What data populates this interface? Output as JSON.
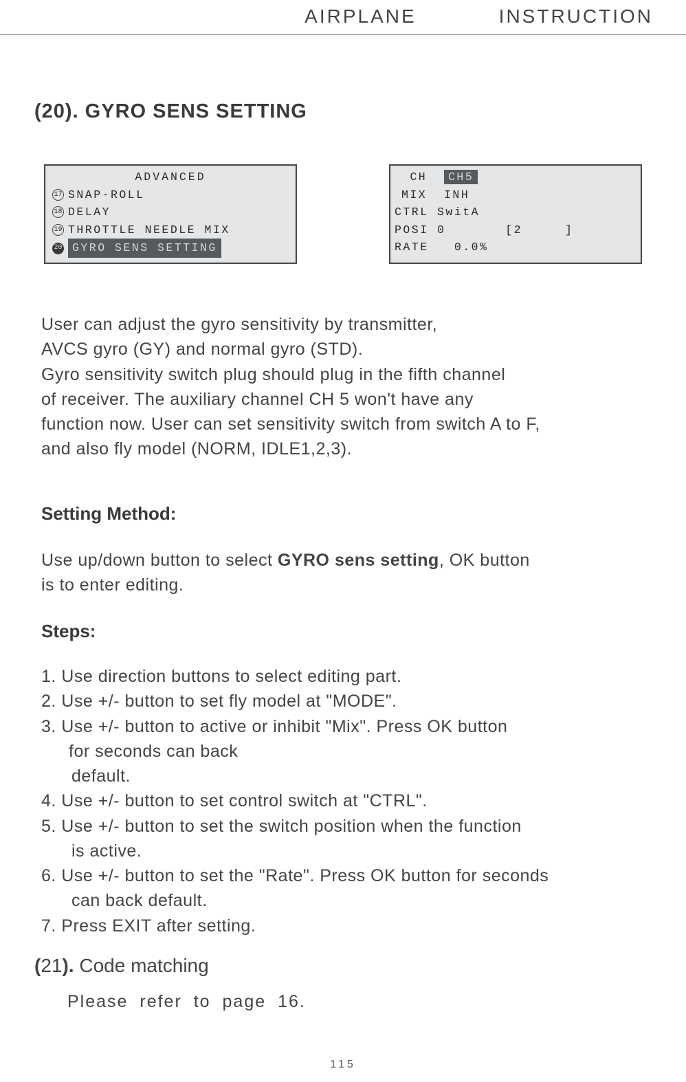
{
  "header": {
    "left": "AIRPLANE",
    "right": "INSTRUCTION"
  },
  "section20": {
    "title": "(20). GYRO SENS SETTING"
  },
  "lcd_a": {
    "title": "ADVANCED",
    "items": [
      {
        "num": "17",
        "label": "SNAP-ROLL"
      },
      {
        "num": "18",
        "label": "DELAY"
      },
      {
        "num": "19",
        "label": "THROTTLE NEEDLE MIX"
      },
      {
        "num": "20",
        "label": "GYRO SENS SETTING"
      }
    ]
  },
  "lcd_b": {
    "ch_label": "CH",
    "ch_val": "CH5",
    "mix_label": "MIX",
    "mix_val": "INH",
    "ctrl_label": "CTRL",
    "ctrl_val": "SwitA",
    "posi_label": "POSI",
    "posi_val": "0",
    "posi_right": "[2     ]",
    "rate_label": "RATE",
    "rate_val": "0.0%"
  },
  "intro": {
    "l1": "User can adjust the gyro sensitivity by transmitter,",
    "l2": "AVCS gyro (GY) and normal gyro (STD).",
    "l3": "Gyro sensitivity switch plug should plug in the fifth channel",
    "l4": "of receiver. The auxiliary channel CH 5 won't have any",
    "l5": "function now. User can set sensitivity switch from switch A to F,",
    "l6": "and also fly model (NORM, IDLE1,2,3)."
  },
  "method": {
    "heading": "Setting Method:",
    "p_pre": "Use up/down button to select ",
    "p_bold": "GYRO sens setting",
    "p_post": ", OK button",
    "p_l2": "is to enter editing."
  },
  "steps": {
    "heading": "Steps:",
    "s1": "1. Use direction buttons to select editing part.",
    "s2": "2. Use +/- button to set fly model at \"MODE\".",
    "s3a": "3. Use +/- button to active or inhibit \"Mix\". Press OK button",
    "s3b": "for seconds can back",
    "s3c": "default.",
    "s4": "4. Use +/- button to set control switch at \"CTRL\".",
    "s5a": "5. Use +/- button to set the switch position when the function",
    "s5b": "is active.",
    "s6a": "6. Use +/- button to set the \"Rate\". Press OK button for seconds",
    "s6b": "can back default.",
    "s7": "7. Press EXIT after setting."
  },
  "section21": {
    "paren_open": "(",
    "num": "21",
    "paren_close": ").",
    "label": " Code matching",
    "refer": "Please refer to page 16."
  },
  "page_number": "115"
}
